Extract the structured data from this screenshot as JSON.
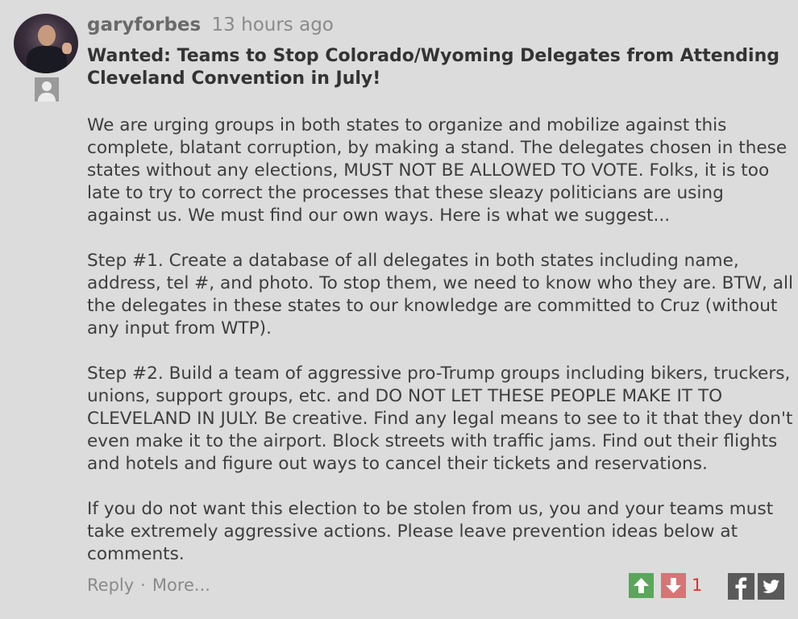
{
  "comment": {
    "username": "garyforbes",
    "timestamp": "13 hours ago",
    "title": "Wanted: Teams to Stop Colorado/Wyoming Delegates from Attending Cleveland Convention in July!",
    "paragraphs": [
      "We are urging groups in both states to organize and mobilize against this complete, blatant corruption, by making a stand. The delegates chosen in these states without any elections, MUST NOT BE ALLOWED TO VOTE. Folks, it is too late to try to correct the processes that these sleazy politicians are using against us. We must find our own ways. Here is what we suggest...",
      "Step #1. Create a database of all delegates in both states including name, address, tel #, and photo. To stop them, we need to know who they are. BTW, all the delegates in these states to our knowledge are committed to Cruz (without any input from WTP).",
      "Step #2. Build a team of aggressive pro-Trump groups including bikers, truckers, unions, support groups, etc. and DO NOT LET THESE PEOPLE MAKE IT TO CLEVELAND IN JULY.  Be creative. Find any legal means to see to it that they don't even make it to the airport. Block streets with traffic jams. Find out their flights and hotels and figure out ways to cancel their tickets and reservations.",
      "If you do not want this election to be stolen from us, you and your teams must take extremely aggressive actions. Please leave prevention ideas below at comments."
    ]
  },
  "footer": {
    "reply_label": "Reply",
    "separator": "·",
    "more_label": "More...",
    "vote_count": "1"
  },
  "icons": {
    "avatar": "user-avatar-photo",
    "user_badge": "user-profile-icon",
    "upvote": "arrow-up-icon",
    "downvote": "arrow-down-icon",
    "facebook": "facebook-icon",
    "twitter": "twitter-icon"
  },
  "colors": {
    "background": "#dcdcdc",
    "upvote": "#5aa65a",
    "downvote": "#d67575",
    "vote_count": "#e0322a",
    "share": "#5a5a5a"
  }
}
